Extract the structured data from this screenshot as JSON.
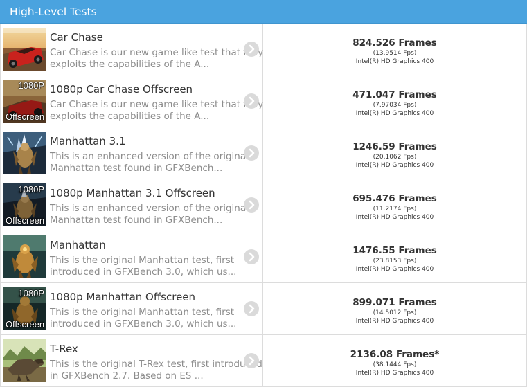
{
  "section": {
    "title": "High-Level Tests"
  },
  "colors": {
    "header": "#4aa3df",
    "border": "#dcdcdc",
    "description": "#8c8c8c",
    "arrow_button": "#dadada"
  },
  "tests": [
    {
      "name": "Car Chase",
      "description_line1": "Car Chase is our new game like test that fully",
      "description_line2": "exploits the capabilities of the A...",
      "score": "824.526 Frames",
      "fps": "(13.9514 Fps)",
      "device": "Intel(R) HD Graphics 400",
      "thumb": "car-chase-thumbnail",
      "badge_top": "",
      "badge_bottom": ""
    },
    {
      "name": "1080p Car Chase Offscreen",
      "description_line1": "Car Chase is our new game like test that fully",
      "description_line2": "exploits the capabilities of the A...",
      "score": "471.047 Frames",
      "fps": "(7.97034 Fps)",
      "device": "Intel(R) HD Graphics 400",
      "thumb": "car-chase-offscreen-thumbnail",
      "badge_top": "1080P",
      "badge_bottom": "Offscreen"
    },
    {
      "name": "Manhattan 3.1",
      "description_line1": "This is an enhanced version of the original",
      "description_line2": "Manhattan test found in GFXBench...",
      "score": "1246.59 Frames",
      "fps": "(20.1062 Fps)",
      "device": "Intel(R) HD Graphics 400",
      "thumb": "manhattan-31-thumbnail",
      "badge_top": "",
      "badge_bottom": ""
    },
    {
      "name": "1080p Manhattan 3.1 Offscreen",
      "description_line1": "This is an enhanced version of the original",
      "description_line2": "Manhattan test found in GFXBench...",
      "score": "695.476 Frames",
      "fps": "(11.2174 Fps)",
      "device": "Intel(R) HD Graphics 400",
      "thumb": "manhattan-31-offscreen-thumbnail",
      "badge_top": "1080P",
      "badge_bottom": "Offscreen"
    },
    {
      "name": "Manhattan",
      "description_line1": "This is the original Manhattan test, first",
      "description_line2": "introduced in GFXBench 3.0, which us...",
      "score": "1476.55 Frames",
      "fps": "(23.8153 Fps)",
      "device": "Intel(R) HD Graphics 400",
      "thumb": "manhattan-thumbnail",
      "badge_top": "",
      "badge_bottom": ""
    },
    {
      "name": "1080p Manhattan Offscreen",
      "description_line1": "This is the original Manhattan test, first",
      "description_line2": "introduced in GFXBench 3.0, which us...",
      "score": "899.071 Frames",
      "fps": "(14.5012 Fps)",
      "device": "Intel(R) HD Graphics 400",
      "thumb": "manhattan-offscreen-thumbnail",
      "badge_top": "1080P",
      "badge_bottom": "Offscreen"
    },
    {
      "name": "T-Rex",
      "description_line1": "This is the original T-Rex test, first introduced",
      "description_line2": "in GFXBench 2.7. Based on ES ...",
      "score": "2136.08 Frames*",
      "fps": "(38.1444 Fps)",
      "device": "Intel(R) HD Graphics 400",
      "thumb": "t-rex-thumbnail",
      "badge_top": "",
      "badge_bottom": ""
    }
  ]
}
